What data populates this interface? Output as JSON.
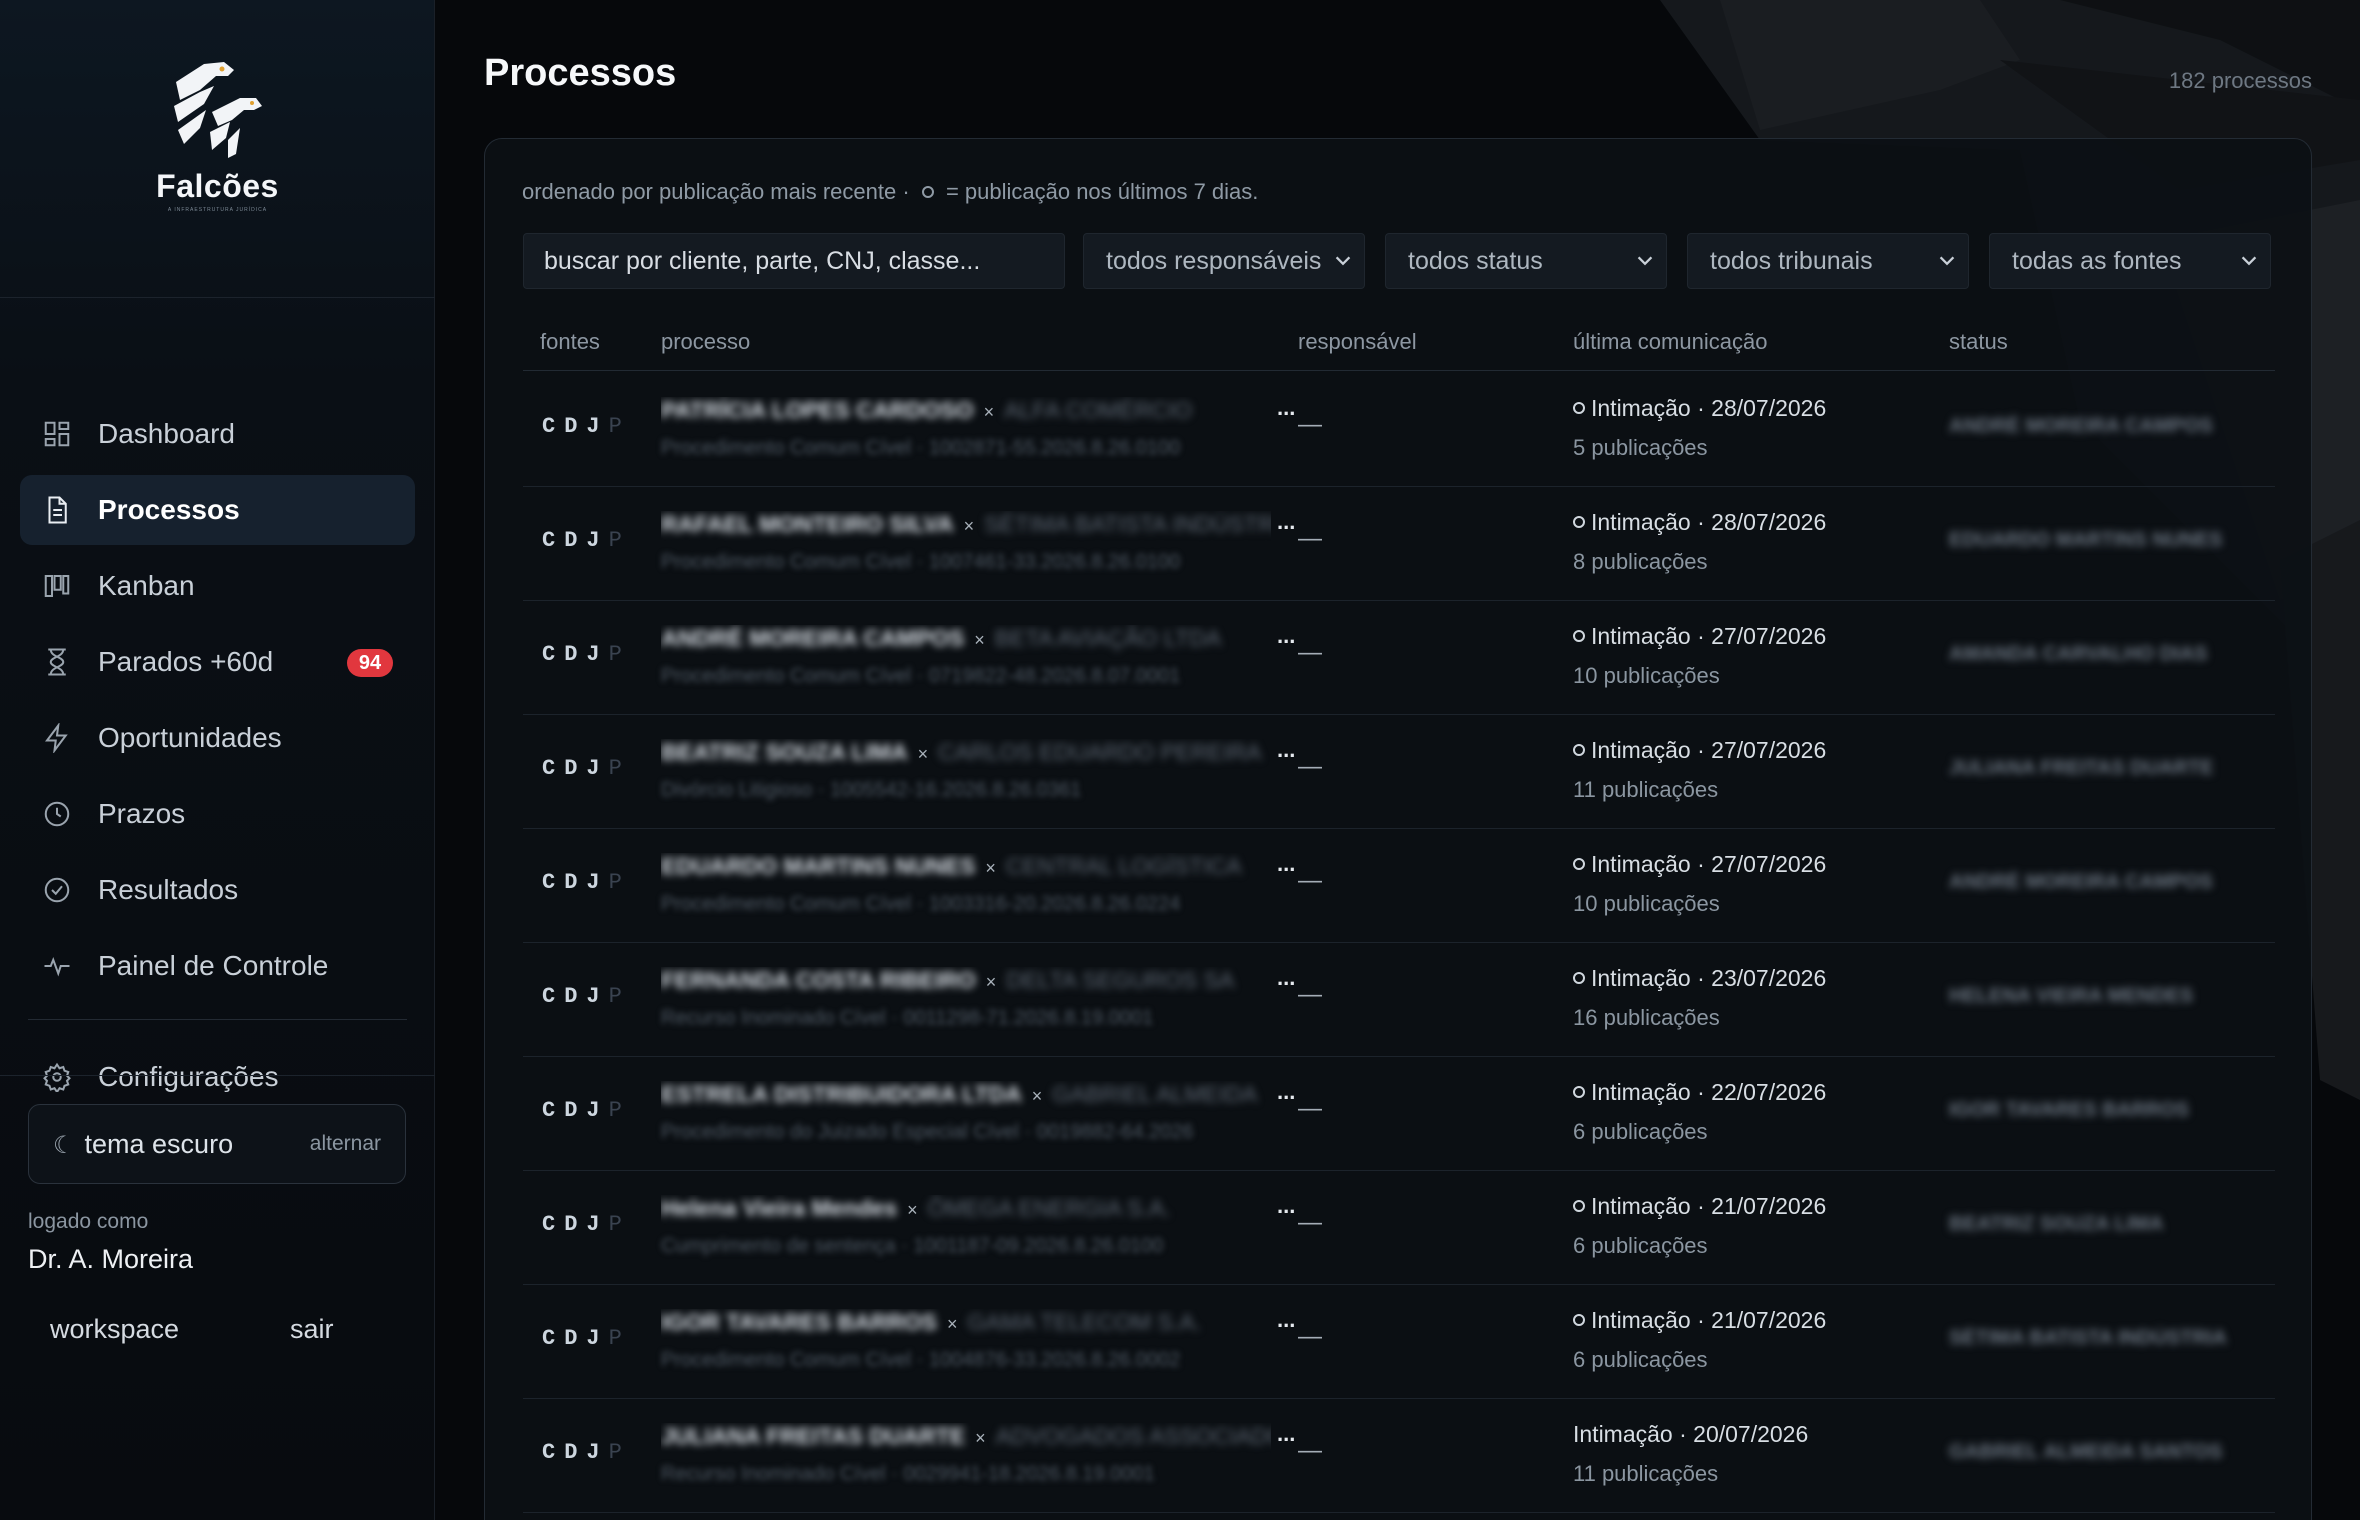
{
  "app": {
    "name": "Falcões",
    "tagline": "A INFRAESTRUTURA JURÍDICA",
    "logo_icon": "falcon-logo-icon"
  },
  "sidebar": {
    "items": [
      {
        "label": "Dashboard",
        "icon": "grid-icon",
        "active": false
      },
      {
        "label": "Processos",
        "icon": "document-icon",
        "active": true
      },
      {
        "label": "Kanban",
        "icon": "kanban-icon",
        "active": false
      },
      {
        "label": "Parados +60d",
        "icon": "hourglass-icon",
        "active": false,
        "badge": "94"
      },
      {
        "label": "Oportunidades",
        "icon": "bolt-icon",
        "active": false
      },
      {
        "label": "Prazos",
        "icon": "clock-icon",
        "active": false
      },
      {
        "label": "Resultados",
        "icon": "check-circle-icon",
        "active": false
      },
      {
        "label": "Painel de Controle",
        "icon": "pulse-icon",
        "active": false
      }
    ],
    "settings_label": "Configurações",
    "theme": {
      "label": "tema escuro",
      "toggle": "alternar",
      "icon": "moon-icon"
    },
    "logged_label": "logado como",
    "user": "Dr. A. Moreira",
    "workspace_label": "workspace",
    "exit_label": "sair"
  },
  "main": {
    "title": "Processos",
    "count": "182 processos",
    "hint_before": "ordenado por publicação mais recente ·",
    "hint_after": "= publicação nos últimos 7 dias.",
    "search_placeholder": "buscar por cliente, parte, CNJ, classe...",
    "filters": {
      "responsavel": "todos responsáveis",
      "status": "todos status",
      "tribunais": "todos tribunais",
      "fontes": "todas as fontes"
    },
    "columns": {
      "fontes": "fontes",
      "processo": "processo",
      "responsavel": "responsável",
      "comunicacao": "última comunicação",
      "status": "status"
    },
    "sources": {
      "active": "CDJ",
      "inactive": "P"
    },
    "rows": [
      {
        "party": "PATRÍCIA LOPES CARDOSO",
        "other": "ALFA COMÉRCIO",
        "sub": "Procedimento Comum Cível · 1002871-55.2026.8.26.0100",
        "resp": "—",
        "comm": "Intimação · 28/07/2026",
        "recent": true,
        "pubs": "5 publicações",
        "status": "ANDRÉ MOREIRA CAMPOS"
      },
      {
        "party": "RAFAEL MONTEIRO SILVA",
        "other": "SÉTIMA BATISTA INDÚSTRIA",
        "sub": "Procedimento Comum Cível · 1007461-33.2026.8.26.0100",
        "resp": "—",
        "comm": "Intimação · 28/07/2026",
        "recent": true,
        "pubs": "8 publicações",
        "status": "EDUARDO MARTINS NUNES"
      },
      {
        "party": "ANDRÉ MOREIRA CAMPOS",
        "other": "BETA AVIAÇÃO LTDA",
        "sub": "Procedimento Comum Cível · 0719822-48.2026.8.07.0001",
        "resp": "—",
        "comm": "Intimação · 27/07/2026",
        "recent": true,
        "pubs": "10 publicações",
        "status": "AMANDA CARVALHO DIAS"
      },
      {
        "party": "BEATRIZ SOUZA LIMA",
        "other": "CARLOS EDUARDO PEREIRA",
        "sub": "Divórcio Litigioso · 1005542-16.2026.8.26.0361",
        "resp": "—",
        "comm": "Intimação · 27/07/2026",
        "recent": true,
        "pubs": "11 publicações",
        "status": "JULIANA FREITAS DUARTE"
      },
      {
        "party": "EDUARDO MARTINS NUNES",
        "other": "CENTRAL LOGÍSTICA",
        "sub": "Procedimento Comum Cível · 1003316-20.2026.8.26.0224",
        "resp": "—",
        "comm": "Intimação · 27/07/2026",
        "recent": true,
        "pubs": "10 publicações",
        "status": "ANDRÉ MOREIRA CAMPOS"
      },
      {
        "party": "FERNANDA COSTA RIBEIRO",
        "other": "DELTA SEGUROS SA",
        "sub": "Recurso Inominado Cível · 0011298-71.2026.8.19.0001",
        "resp": "—",
        "comm": "Intimação · 23/07/2026",
        "recent": true,
        "pubs": "16 publicações",
        "status": "HELENA VIEIRA MENDES"
      },
      {
        "party": "ESTRELA DISTRIBUIDORA LTDA",
        "other": "GABRIEL ALMEIDA",
        "sub": "Procedimento do Juizado Especial Cível · 0019882-64.2026",
        "resp": "—",
        "comm": "Intimação · 22/07/2026",
        "recent": true,
        "pubs": "6 publicações",
        "status": "IGOR TAVARES BARROS"
      },
      {
        "party": "Helena Vieira Mendes",
        "other": "ÔMEGA ENERGIA S.A.",
        "sub": "Cumprimento de sentença · 1001187-09.2026.8.26.0100",
        "resp": "—",
        "comm": "Intimação · 21/07/2026",
        "recent": true,
        "pubs": "6 publicações",
        "status": "BEATRIZ SOUZA LIMA"
      },
      {
        "party": "IGOR TAVARES BARROS",
        "other": "GAMA TELECOM S.A.",
        "sub": "Procedimento Comum Cível · 1004876-33.2026.8.26.0002",
        "resp": "—",
        "comm": "Intimação · 21/07/2026",
        "recent": true,
        "pubs": "6 publicações",
        "status": "SÉTIMA BATISTA INDÚSTRIA"
      },
      {
        "party": "JULIANA FREITAS DUARTE",
        "other": "ADVOGADOS ASSOCIADOS",
        "sub": "Recurso Inominado Cível · 0029941-18.2026.8.19.0001",
        "resp": "—",
        "comm": "Intimação · 20/07/2026",
        "recent": false,
        "pubs": "11 publicações",
        "status": "GABRIEL ALMEIDA SANTOS"
      }
    ]
  },
  "colors": {
    "accent_badge": "#e1373e",
    "active_nav": "#16212e",
    "panel": "#0c1015"
  }
}
